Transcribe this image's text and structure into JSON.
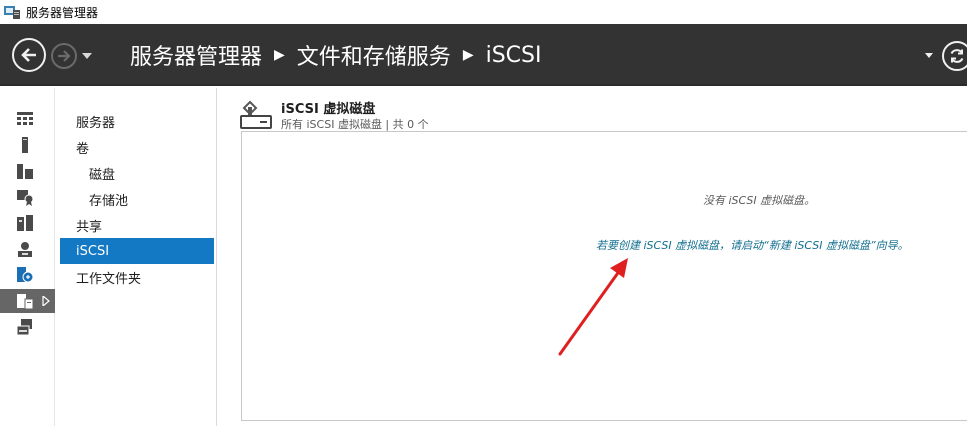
{
  "window": {
    "title": "服务器管理器"
  },
  "header": {
    "breadcrumb": [
      "服务器管理器",
      "文件和存储服务",
      "iSCSI"
    ]
  },
  "subnav": {
    "items": [
      {
        "label": "服务器",
        "level": 1
      },
      {
        "label": "卷",
        "level": 1
      },
      {
        "label": "磁盘",
        "level": 2
      },
      {
        "label": "存储池",
        "level": 2
      },
      {
        "label": "共享",
        "level": 1
      },
      {
        "label": "iSCSI",
        "level": 1,
        "selected": true
      },
      {
        "label": "工作文件夹",
        "level": 1
      }
    ]
  },
  "tile": {
    "title": "iSCSI 虚拟磁盘",
    "subtitle": "所有 iSCSI 虚拟磁盘 | 共 0 个",
    "empty_message": "没有 iSCSI 虚拟磁盘。",
    "create_link": "若要创建 iSCSI 虚拟磁盘，请启动“新建 iSCSI 虚拟磁盘”向导。"
  },
  "colors": {
    "header_bg": "#333333",
    "selection": "#1479c4",
    "link": "#136f8f",
    "annotation_arrow": "#e02020"
  },
  "icons": {
    "leftbar": [
      "dashboard-icon",
      "local-server-icon",
      "all-servers-icon",
      "ad-cs-icon",
      "ad-ds-icon",
      "ad-rms-icon",
      "dhcp-icon",
      "file-storage-icon",
      "print-services-icon"
    ]
  }
}
